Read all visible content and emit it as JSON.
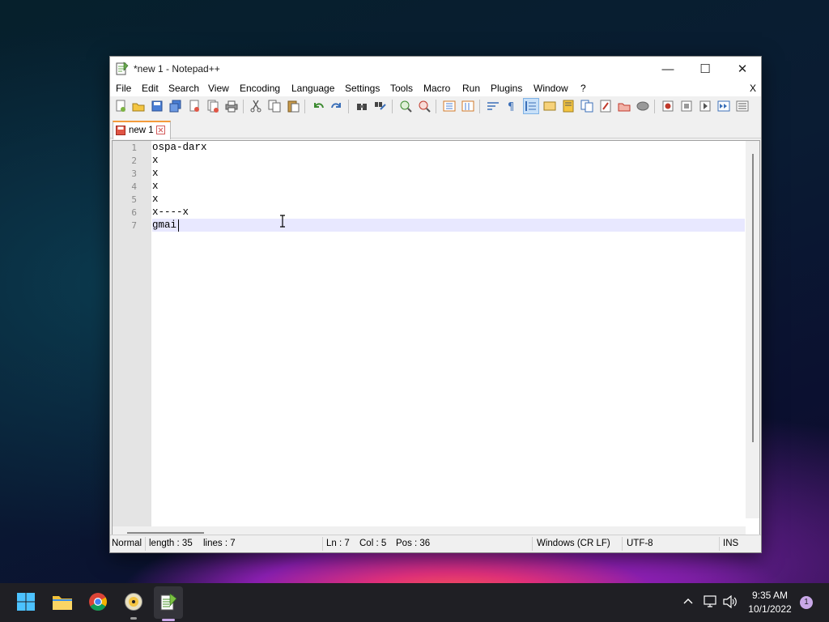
{
  "window": {
    "title": "*new 1 - Notepad++",
    "caption": {
      "minimize": "—",
      "maximize": "☐",
      "close": "✕"
    }
  },
  "menu": [
    "File",
    "Edit",
    "Search",
    "View",
    "Encoding",
    "Language",
    "Settings",
    "Tools",
    "Macro",
    "Run",
    "Plugins",
    "Window",
    "?"
  ],
  "menu_close": "X",
  "tab": {
    "label": "new 1"
  },
  "editor": {
    "line_numbers": [
      "1",
      "2",
      "3",
      "4",
      "5",
      "6",
      "7"
    ],
    "lines": [
      "ospa-darx",
      "x",
      "x",
      "x",
      "x",
      "x----x",
      "gmai"
    ],
    "current_line": 7
  },
  "status": {
    "mode": "Normal",
    "length": "length : 35",
    "lines": "lines : 7",
    "ln": "Ln : 7",
    "col": "Col : 5",
    "pos": "Pos : 36",
    "eol": "Windows (CR LF)",
    "encoding": "UTF-8",
    "ins": "INS"
  },
  "taskbar": {
    "time": "9:35 AM",
    "date": "10/1/2022",
    "notification_count": "1"
  }
}
